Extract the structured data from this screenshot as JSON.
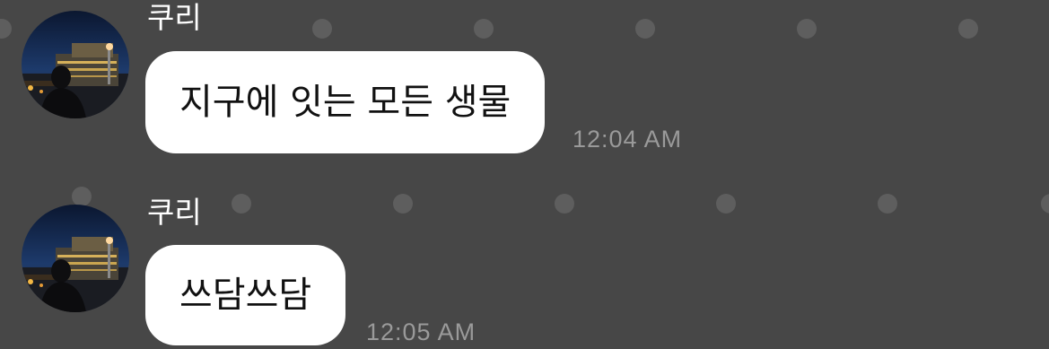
{
  "chat": {
    "messages": [
      {
        "sender": "쿠리",
        "text": "지구에 잇는 모든 생물",
        "time": "12:04 AM"
      },
      {
        "sender": "쿠리",
        "text": "쓰담쓰담",
        "time": "12:05 AM"
      }
    ]
  },
  "colors": {
    "background": "#474747",
    "pattern_dot": "#5e5e5e",
    "bubble": "#ffffff",
    "sender_name": "#ffffff",
    "timestamp": "#9a9a9a"
  }
}
